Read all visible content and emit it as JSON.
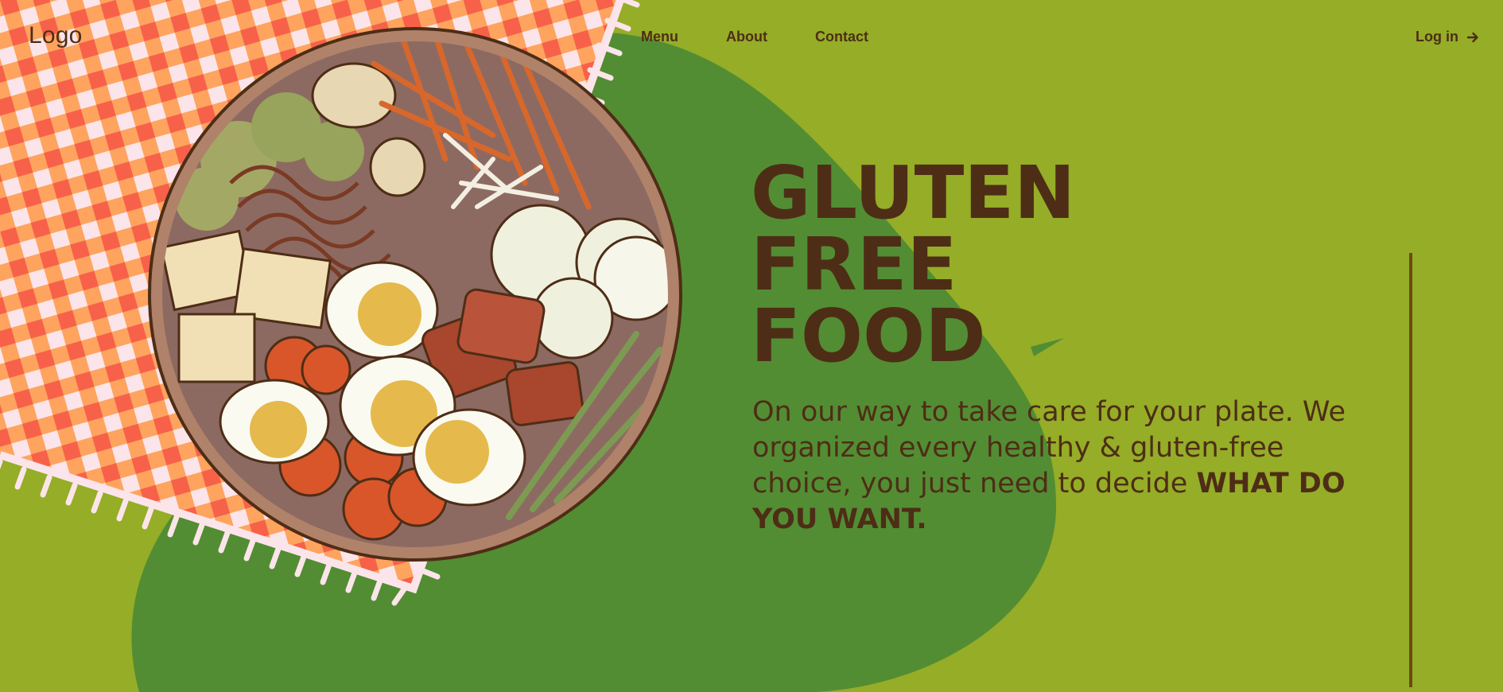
{
  "header": {
    "logo": "Logo",
    "nav": [
      "Menu",
      "About",
      "Contact"
    ],
    "login_label": "Log in",
    "login_icon": "arrow-right-icon"
  },
  "hero": {
    "title_lines": [
      "GLUTEN",
      "FREE",
      "FOOD"
    ],
    "description": "On our way to take care for your plate. We organized every healthy & gluten-free choice, you just need to decide",
    "description_emphasis": "WHAT DO YOU WANT."
  },
  "colors": {
    "background": "#95ad27",
    "blob": "#528d33",
    "text": "#4e2d16",
    "accent_line": "#6e4a14",
    "tablecloth_red": "#f7614a",
    "tablecloth_orange": "#fea45f",
    "tablecloth_light": "#fce5ea"
  }
}
